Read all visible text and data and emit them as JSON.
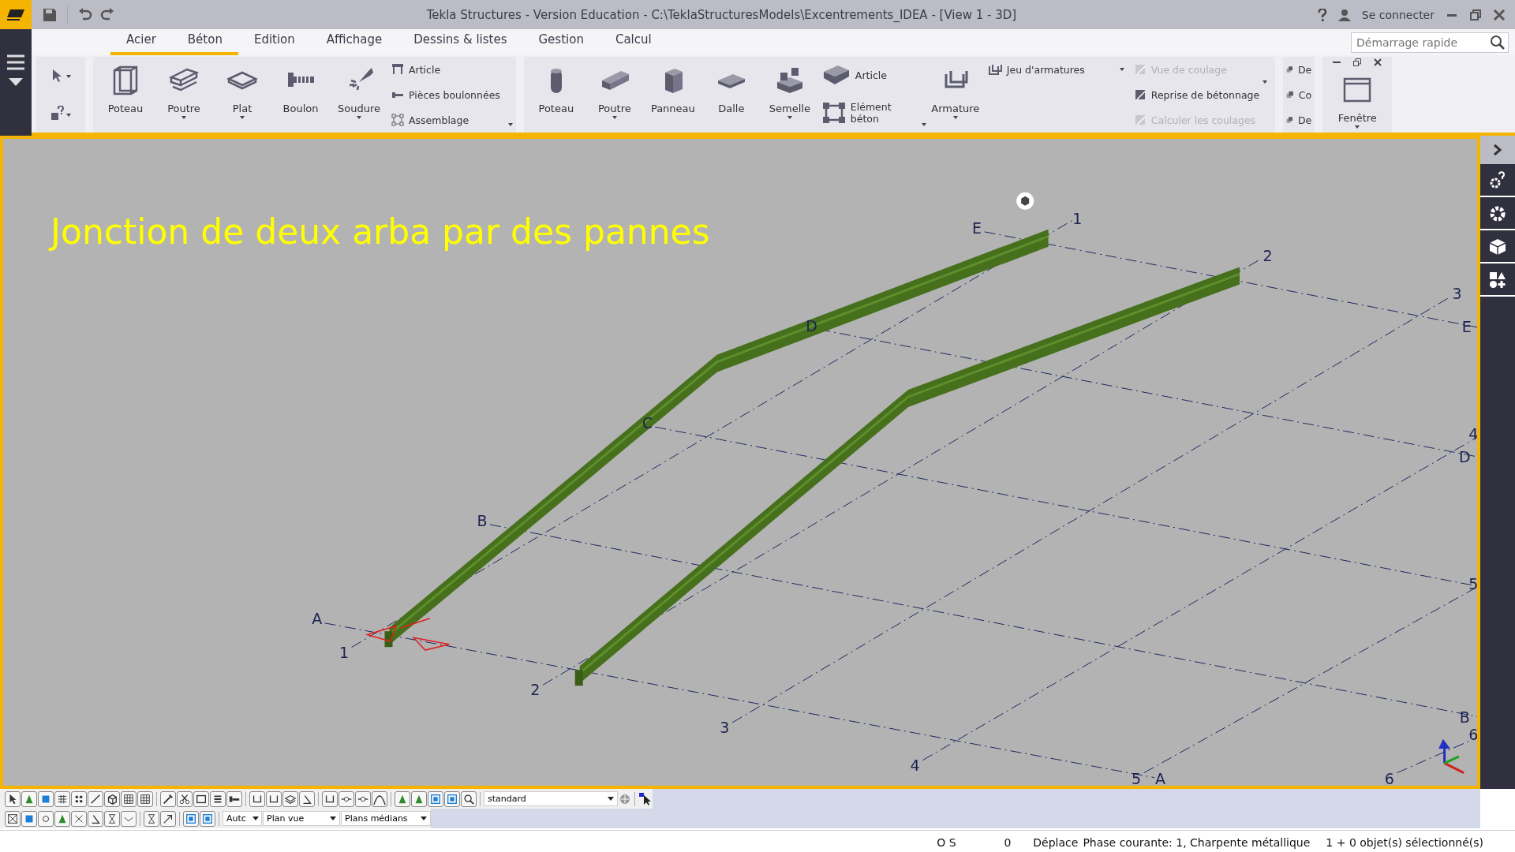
{
  "window": {
    "title": "Tekla Structures - Version Education - C:\\TeklaStructuresModels\\Excentrements_IDEA  - [View 1 - 3D]"
  },
  "account": {
    "label": "Se connecter"
  },
  "tabs": [
    {
      "label": "Acier",
      "selected": true
    },
    {
      "label": "Béton",
      "selected": true
    },
    {
      "label": "Edition",
      "selected": false
    },
    {
      "label": "Affichage",
      "selected": false
    },
    {
      "label": "Dessins & listes",
      "selected": false
    },
    {
      "label": "Gestion",
      "selected": false
    },
    {
      "label": "Calcul",
      "selected": false
    }
  ],
  "quick_launch": {
    "placeholder": "Démarrage rapide"
  },
  "ribbon": {
    "steel": {
      "large": [
        {
          "label": "Poteau",
          "dropdown": false
        },
        {
          "label": "Poutre",
          "dropdown": true
        },
        {
          "label": "Plat",
          "dropdown": true
        },
        {
          "label": "Boulon",
          "dropdown": false
        },
        {
          "label": "Soudure",
          "dropdown": true
        }
      ],
      "small": [
        "Article",
        "Pièces boulonnées",
        "Assemblage"
      ]
    },
    "concrete": {
      "large": [
        {
          "label": "Poteau",
          "dropdown": false
        },
        {
          "label": "Poutre",
          "dropdown": true
        },
        {
          "label": "Panneau",
          "dropdown": false
        },
        {
          "label": "Dalle",
          "dropdown": false
        },
        {
          "label": "Semelle",
          "dropdown": true
        }
      ],
      "article": "Article",
      "element": "Elément béton",
      "armature": {
        "label": "Armature",
        "dropdown": true
      },
      "rebar_set": "Jeu d'armatures",
      "pour": [
        {
          "label": "Vue de coulage",
          "disabled": true
        },
        {
          "label": "Reprise de bétonnage",
          "disabled": false
        },
        {
          "label": "Calculer les coulages",
          "disabled": true
        }
      ]
    },
    "partial_group": [
      "De",
      "Co",
      "De"
    ],
    "window_group": {
      "label": "Fenêtre",
      "dropdown": true
    }
  },
  "viewport": {
    "caption": "Jonction de deux arba par des pannes",
    "grid_labels": [
      "1",
      "2",
      "3",
      "4",
      "5",
      "6",
      "1",
      "2",
      "3",
      "4",
      "5",
      "6",
      "A",
      "B",
      "C",
      "D",
      "E",
      "E",
      "D",
      "B",
      "A"
    ]
  },
  "toolbar": {
    "view_select": "standard",
    "dropdowns": [
      "Autc",
      "Plan vue",
      "Plans médians"
    ]
  },
  "status_bar": {
    "snap": "O S",
    "count": "0",
    "mode": "Déplace",
    "phase": "Phase courante: 1, Charpente métallique",
    "selection": "1 + 0 objet(s) sélectionné(s)"
  }
}
